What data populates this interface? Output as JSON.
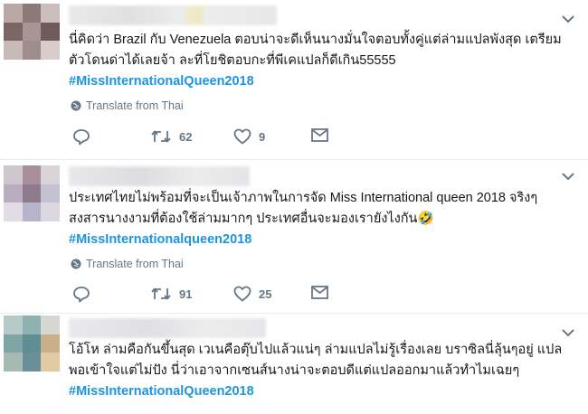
{
  "tweets": [
    {
      "lines": [
        "นี่คิดว่า Brazil กับ Venezuela ตอบน่าจะดีเห็นนางมั่นใจตอบทั้งคู่แต่ล่ามแปลพังสุด เตรียม",
        "ตัวโดนด่าได้เลยจ้า ละที่โยชิตอบกะที่พีเคแปลก็ดีเกิน55555"
      ],
      "hashtag": "#MissInternationalQueen2018",
      "translate": "Translate from Thai",
      "retweets": "62",
      "likes": "9"
    },
    {
      "lines": [
        "ประเทศไทยไม่พร้อมที่จะเป็นเจ้าภาพในการจัด Miss International queen 2018 จริงๆ",
        "สงสารนางงามที่ต้องใช้ล่ามมากๆ ประเทศอื่นจะมองเรายังไงกัน🤣"
      ],
      "hashtag": "#MissInternationalqueen2018",
      "translate": "Translate from Thai",
      "retweets": "91",
      "likes": "25"
    },
    {
      "lines": [
        "โอ้โห ล่ามคือกันขึ้นสุด เวเนคือตุ๊บไปแล้วแน่ๆ ล่ามแปลไม่รู้เรื่องเลย บราซิลนี่ลุ้นๆอยู่ แปล",
        "พอเข้าใจแต่ไม่ปัง นี่ว่าเอาจากเซนส์นางน่าจะตอบดีแต่แปลออกมาแล้วทำไมเฉยๆ"
      ],
      "hashtag": "#MissInternationalQueen2018"
    }
  ],
  "colors": {
    "text": "#14171a",
    "hashtag": "#1b95e0",
    "muted": "#657786",
    "divider": "#e6ecf0"
  },
  "icons": [
    "reply-icon",
    "retweet-icon",
    "heart-icon",
    "message-icon",
    "globe-icon",
    "chevron-down-icon"
  ]
}
